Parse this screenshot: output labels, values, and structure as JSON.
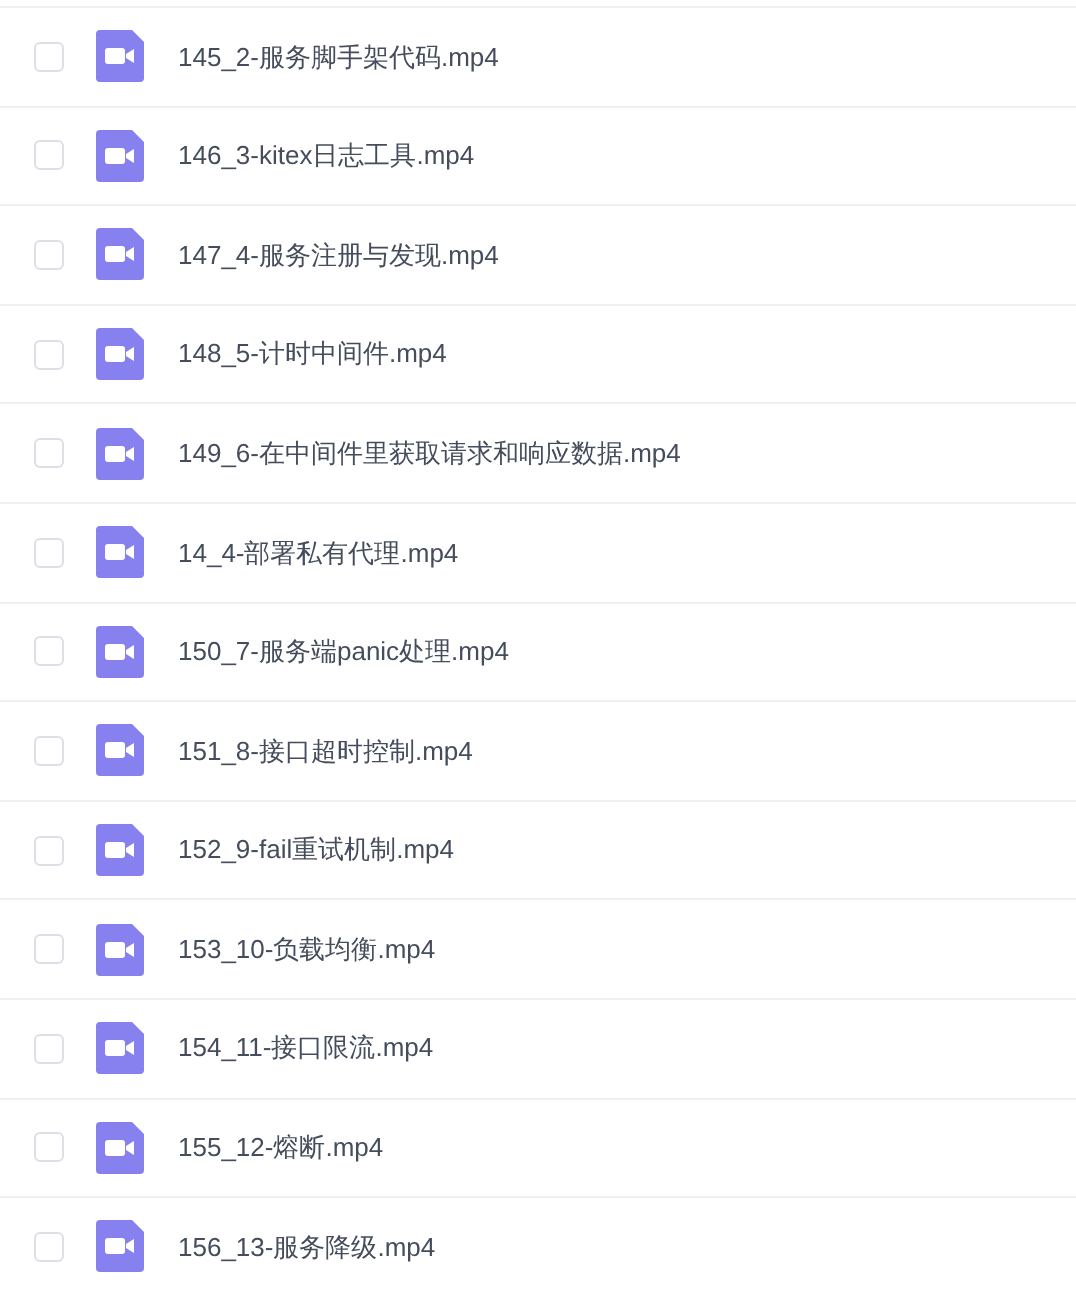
{
  "files": [
    {
      "name": "145_2-服务脚手架代码.mp4",
      "checked": false
    },
    {
      "name": "146_3-kitex日志工具.mp4",
      "checked": false
    },
    {
      "name": "147_4-服务注册与发现.mp4",
      "checked": false
    },
    {
      "name": "148_5-计时中间件.mp4",
      "checked": false
    },
    {
      "name": "149_6-在中间件里获取请求和响应数据.mp4",
      "checked": false
    },
    {
      "name": "14_4-部署私有代理.mp4",
      "checked": false
    },
    {
      "name": "150_7-服务端panic处理.mp4",
      "checked": false
    },
    {
      "name": "151_8-接口超时控制.mp4",
      "checked": false
    },
    {
      "name": "152_9-fail重试机制.mp4",
      "checked": false
    },
    {
      "name": "153_10-负载均衡.mp4",
      "checked": false
    },
    {
      "name": "154_11-接口限流.mp4",
      "checked": false
    },
    {
      "name": "155_12-熔断.mp4",
      "checked": false
    },
    {
      "name": "156_13-服务降级.mp4",
      "checked": false
    }
  ]
}
